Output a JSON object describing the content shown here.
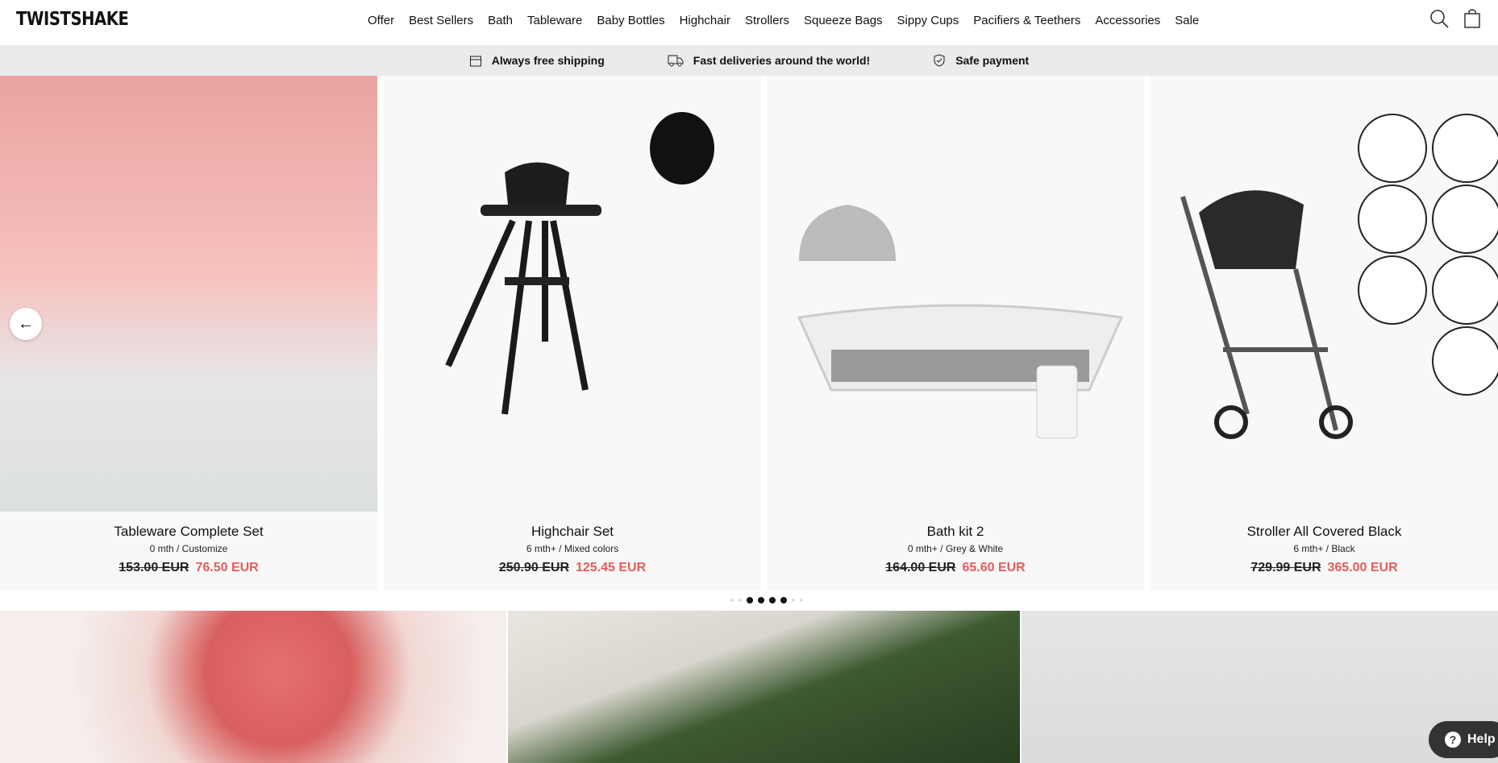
{
  "header": {
    "logo": "TWISTSHAKE",
    "nav": [
      "Offer",
      "Best Sellers",
      "Bath",
      "Tableware",
      "Baby Bottles",
      "Highchair",
      "Strollers",
      "Squeeze Bags",
      "Sippy Cups",
      "Pacifiers & Teethers",
      "Accessories",
      "Sale"
    ]
  },
  "infobar": [
    "Always free shipping",
    "Fast deliveries around the world!",
    "Safe payment"
  ],
  "products": [
    {
      "title": "Tableware Complete Set",
      "sub": "0 mth / Customize",
      "old": "153.00 EUR",
      "new": "76.50 EUR"
    },
    {
      "title": "Highchair Set",
      "sub": "6 mth+ / Mixed colors",
      "old": "250.90 EUR",
      "new": "125.45 EUR"
    },
    {
      "title": "Bath kit 2",
      "sub": "0 mth+ / Grey & White",
      "old": "164.00 EUR",
      "new": "65.60 EUR"
    },
    {
      "title": "Stroller All Covered Black",
      "sub": "6 mth+ / Black",
      "old": "729.99 EUR",
      "new": "365.00 EUR"
    }
  ],
  "help": "Help",
  "colors": {
    "sale": "#e85a5a",
    "infobar": "#ebebeb"
  }
}
